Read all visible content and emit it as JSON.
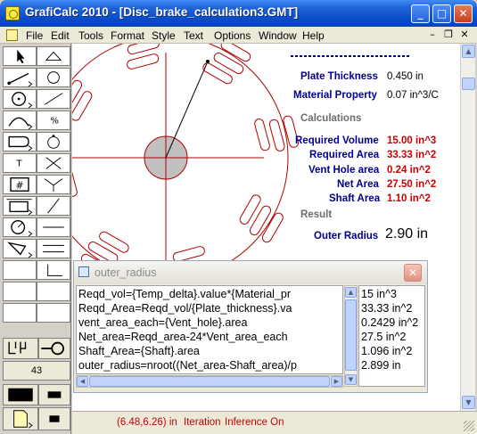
{
  "window": {
    "title": "GrafiCalc 2010 - [Disc_brake_calculation3.GMT]",
    "min_glyph": "_",
    "max_glyph": "□",
    "close_glyph": "✕"
  },
  "menu": {
    "items": [
      "File",
      "Edit",
      "Tools",
      "Format",
      "Style",
      "Text",
      "Options",
      "Window",
      "Help"
    ],
    "mdi_min": "–",
    "mdi_restore": "❐",
    "mdi_close": "✕"
  },
  "toolbox": {
    "text_tool": "T",
    "grid_tool": "#",
    "percent_tool": "%",
    "counter_value": "43"
  },
  "calc": {
    "plate_thickness_label": "Plate Thickness",
    "plate_thickness_value": "0.450 in",
    "material_property_label": "Material Property",
    "material_property_value": "0.07 in^3/C",
    "calculations_heading": "Calculations",
    "required_volume_label": "Required Volume",
    "required_volume_value": "15.00 in^3",
    "required_area_label": "Required Area",
    "required_area_value": "33.33 in^2",
    "vent_hole_area_label": "Vent Hole area",
    "vent_hole_area_value": "0.24 in^2",
    "net_area_label": "Net Area",
    "net_area_value": "27.50 in^2",
    "shaft_area_label": "Shaft Area",
    "shaft_area_value": "1.10 in^2",
    "result_heading": "Result",
    "outer_radius_label": "Outer Radius",
    "outer_radius_value": "2.90 in"
  },
  "float_window": {
    "title": "outer_radius",
    "close_glyph": "✕",
    "formulas": [
      "Reqd_vol={Temp_delta}.value*{Material_pr",
      "Reqd_Area=Reqd_vol/{Plate_thickness}.va",
      "vent_area_each={Vent_hole}.area",
      "Net_area=Reqd_area-24*Vent_area_each",
      "Shaft_Area={Shaft}.area",
      "outer_radius=nroot((Net_area-Shaft_area)/p"
    ],
    "results": [
      "15 in^3",
      "33.33 in^2",
      "0.2429 in^2",
      "27.5 in^2",
      "1.096 in^2",
      "2.899 in"
    ]
  },
  "status": {
    "coords": "(6.48,6.26) in",
    "mode": "Iteration",
    "inference": "Inference On"
  },
  "colors": {
    "drawing": "#b00000",
    "label_navy": "#00008b",
    "value_red": "#cc0000",
    "hub_fill": "#c0c0c0"
  }
}
